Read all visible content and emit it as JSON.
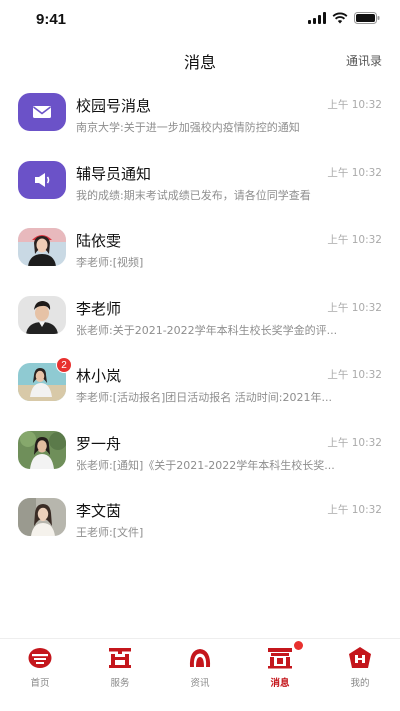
{
  "status_bar": {
    "time": "9:41"
  },
  "header": {
    "title": "消息",
    "contacts_link": "通讯录"
  },
  "messages": [
    {
      "name": "校园号消息",
      "time": "上午 10:32",
      "preview": "南京大学:关于进一步加强校内疫情防控的通知",
      "avatar": "mail-icon"
    },
    {
      "name": "辅导员通知",
      "time": "上午 10:32",
      "preview": "我的成绩:期末考试成绩已发布，请各位同学查看",
      "avatar": "megaphone-icon"
    },
    {
      "name": "陆依雯",
      "time": "上午 10:32",
      "preview": "李老师:[视频]",
      "avatar": "photo-avatar"
    },
    {
      "name": "李老师",
      "time": "上午 10:32",
      "preview": "张老师:关于2021-2022学年本科生校长奖学金的评...",
      "avatar": "photo-avatar"
    },
    {
      "name": "林小岚",
      "time": "上午 10:32",
      "preview": "李老师:[活动报名]团日活动报名 活动时间:2021年...",
      "avatar": "photo-avatar",
      "badge": "2"
    },
    {
      "name": "罗一舟",
      "time": "上午 10:32",
      "preview": "张老师:[通知]《关于2021-2022学年本科生校长奖...",
      "avatar": "photo-avatar"
    },
    {
      "name": "李文茵",
      "time": "上午 10:32",
      "preview": "王老师:[文件]",
      "avatar": "photo-avatar"
    }
  ],
  "tabs": [
    {
      "label": "首页",
      "icon": "home-icon"
    },
    {
      "label": "服务",
      "icon": "service-icon"
    },
    {
      "label": "资讯",
      "icon": "news-icon"
    },
    {
      "label": "消息",
      "icon": "message-icon",
      "active": true
    },
    {
      "label": "我的",
      "icon": "profile-icon"
    }
  ],
  "colors": {
    "accent": "#c4161c",
    "icon_purple": "#6b52c8",
    "badge_red": "#e8312f"
  }
}
